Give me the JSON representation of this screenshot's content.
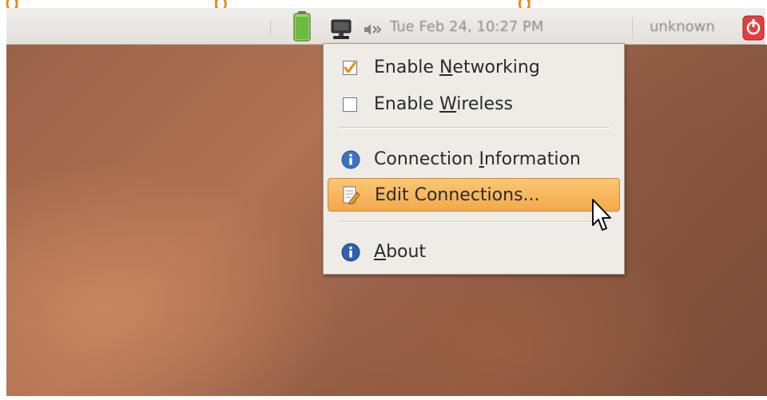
{
  "panel": {
    "clock_text": "Tue Feb 24, 10:27 PM",
    "user_name": "unknown",
    "icons": {
      "battery": "battery-icon",
      "network": "network-computer-icon",
      "volume": "volume-icon",
      "power": "power-icon"
    }
  },
  "menu": {
    "items": [
      {
        "label": "Enable Networking",
        "mnemonic": "N",
        "checked": true,
        "icon": "checkbox-checked"
      },
      {
        "label": "Enable Wireless",
        "mnemonic": "W",
        "checked": false,
        "icon": "checkbox-unchecked"
      },
      {
        "label": "Connection Information",
        "mnemonic": "I",
        "icon": "info-icon"
      },
      {
        "label": "Edit Connections...",
        "highlighted": true,
        "icon": "edit-icon"
      },
      {
        "label": "About",
        "mnemonic": "A",
        "icon": "info-icon"
      }
    ]
  },
  "colors": {
    "highlight": "#f3a94a",
    "menu_bg": "#efebe7",
    "panel_bg": "#e3e0dc",
    "check_orange": "#e6871c",
    "info_blue": "#3b73c4"
  }
}
